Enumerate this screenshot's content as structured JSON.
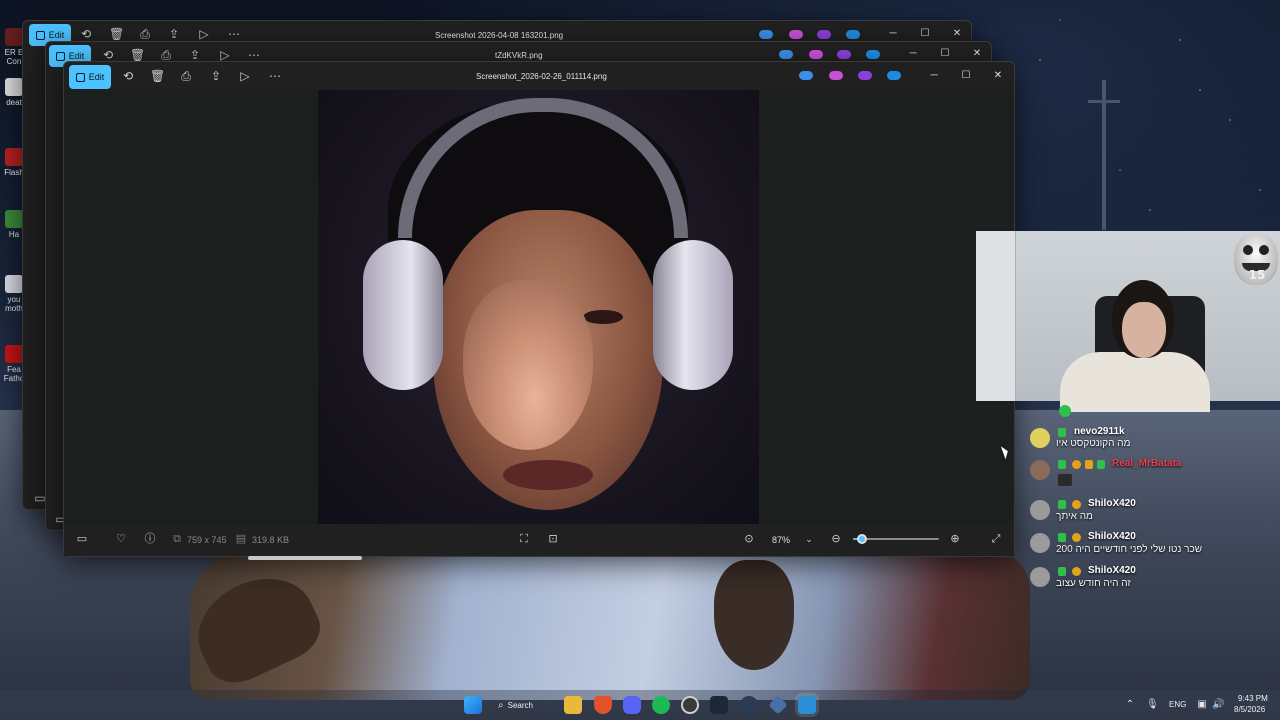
{
  "windows": {
    "back": {
      "title": "Screenshot 2026-04-08 163201.png",
      "edit_label": "Edit"
    },
    "middle": {
      "title": "tZdKVkR.png",
      "edit_label": "Edit"
    },
    "front": {
      "title": "Screenshot_2026-02-26_011114.png",
      "edit_label": "Edit",
      "status": {
        "dimensions": "759 x 745",
        "file_size": "319.8 KB",
        "zoom": "87%",
        "zoom_level": 0.1
      }
    }
  },
  "desktop_icons": [
    {
      "label": "ER E\nCon"
    },
    {
      "label": "deat"
    },
    {
      "label": "Flash"
    },
    {
      "label": "Ha"
    },
    {
      "label": "you\nmoth"
    },
    {
      "label": "Fea\nFatho"
    }
  ],
  "chat": [
    {
      "user": "nevo2911k",
      "user_color": "#6fa8ff",
      "text": "מה הקונטקסט איו"
    },
    {
      "user": "Real_MrBatata",
      "user_color": "#e8414a",
      "text": ""
    },
    {
      "user": "ShiloX420",
      "user_color": "#ffffff",
      "text": "מה איתך"
    },
    {
      "user": "ShiloX420",
      "user_color": "#ffffff",
      "text": "שכר נטו שלי לפני חודשיים היה 200"
    },
    {
      "user": "ShiloX420",
      "user_color": "#ffffff",
      "text": "זה היה חודש עצוב"
    }
  ],
  "overlay": {
    "troll_number": "15"
  },
  "taskbar": {
    "search_label": "Search",
    "lang": "ENG",
    "time": "9:43 PM",
    "date": "8/5/2026"
  },
  "colors": {
    "accent": "#4cc2ff"
  }
}
